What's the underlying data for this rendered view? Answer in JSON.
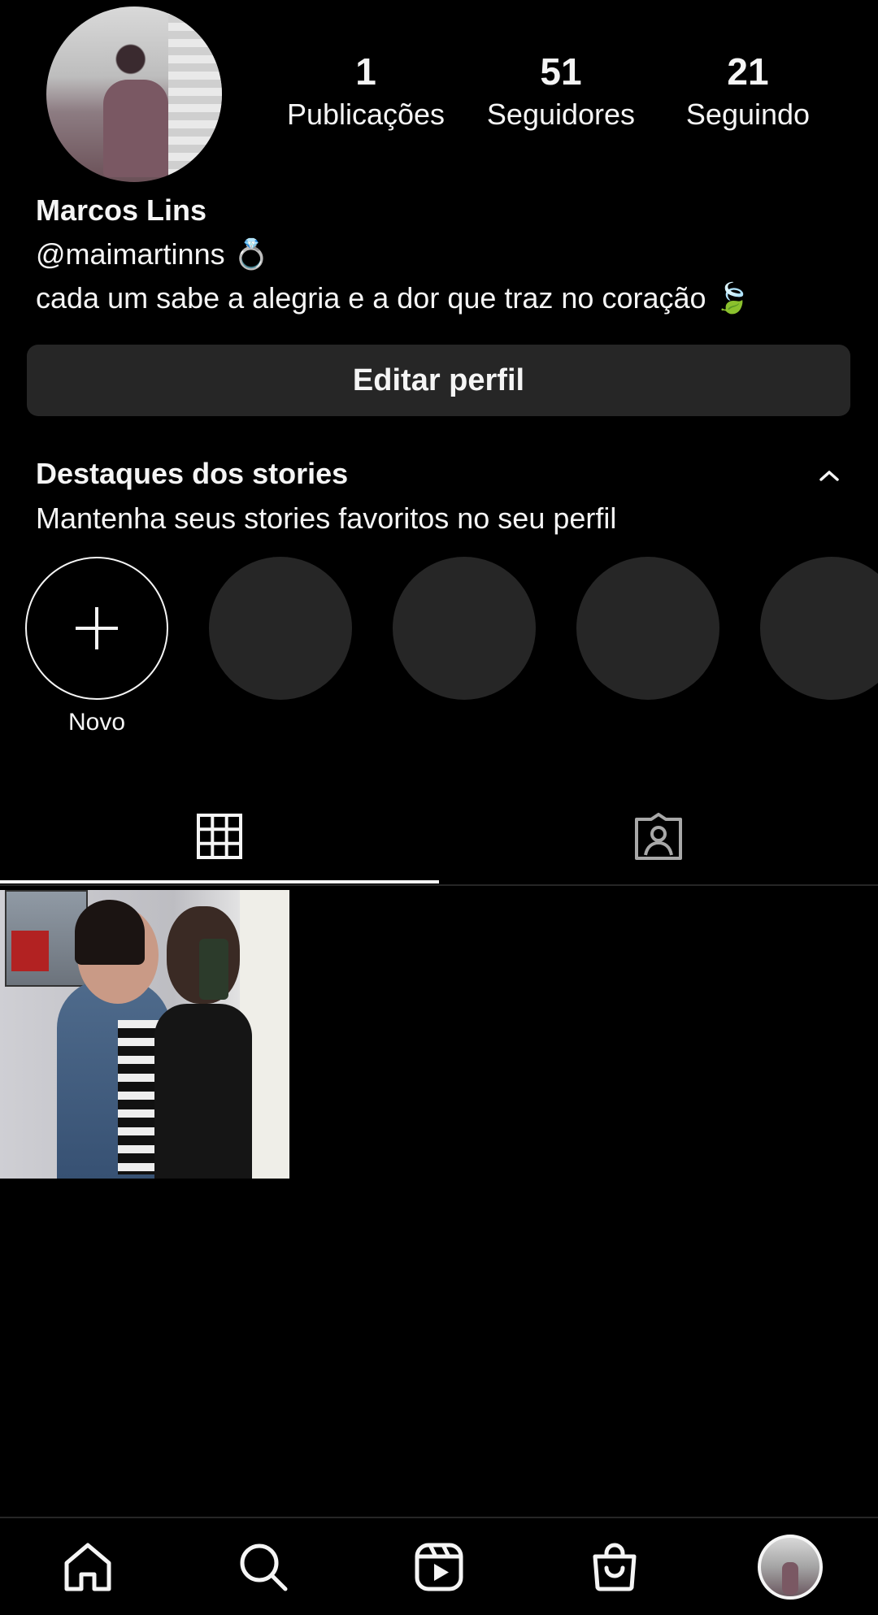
{
  "profile": {
    "name": "Marcos Lins",
    "handle": "@maimartinns 💍",
    "bio": "cada um sabe a alegria e a dor que traz no coração 🍃",
    "stats": [
      {
        "value": "1",
        "label": "Publicações"
      },
      {
        "value": "51",
        "label": "Seguidores"
      },
      {
        "value": "21",
        "label": "Seguindo"
      }
    ],
    "edit_button": "Editar perfil"
  },
  "highlights": {
    "title": "Destaques dos stories",
    "subtitle": "Mantenha seus stories favoritos no seu perfil",
    "new_label": "Novo",
    "placeholders": 4
  },
  "tabs": [
    {
      "icon": "grid-icon",
      "active": true
    },
    {
      "icon": "tagged-icon",
      "active": false
    }
  ],
  "posts": [
    {
      "icon": "photo"
    }
  ],
  "bottom_nav": [
    {
      "icon": "home-icon"
    },
    {
      "icon": "search-icon"
    },
    {
      "icon": "reels-icon"
    },
    {
      "icon": "shop-icon"
    },
    {
      "icon": "profile-avatar"
    }
  ],
  "colors": {
    "background": "#000000",
    "surface": "#262626",
    "text": "#f5f5f5"
  }
}
